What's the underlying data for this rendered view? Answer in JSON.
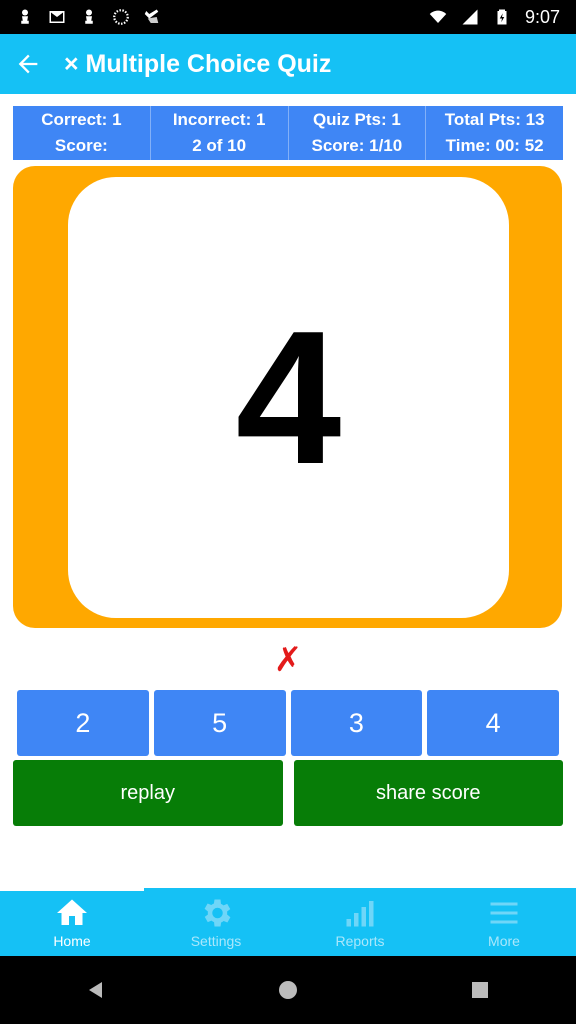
{
  "status_bar": {
    "time": "9:07"
  },
  "app_bar": {
    "title": "× Multiple Choice Quiz"
  },
  "score_header": {
    "correct": "Correct:  1",
    "score_label": "Score:",
    "incorrect": "Incorrect:  1",
    "progress": "2 of 10",
    "quiz_pts": "Quiz Pts: 1",
    "score_value": "Score:  1/10",
    "total_pts": "Total Pts: 13",
    "time": "Time:   00: 52"
  },
  "card": {
    "number": "4"
  },
  "result": {
    "mark": "✗"
  },
  "answers": [
    "2",
    "5",
    "3",
    "4"
  ],
  "actions": {
    "replay": "replay",
    "share": "share score"
  },
  "bottom_nav": [
    {
      "label": "Home",
      "icon": "home-icon"
    },
    {
      "label": "Settings",
      "icon": "gear-icon"
    },
    {
      "label": "Reports",
      "icon": "signal-bars-icon"
    },
    {
      "label": "More",
      "icon": "menu-icon"
    }
  ],
  "colors": {
    "app_bar": "#15c1f5",
    "score_header": "#3f86f5",
    "card_frame": "#ffa800",
    "answer_button": "#3f86f5",
    "action_button": "#077d07",
    "wrong_mark": "#e31b1b"
  }
}
